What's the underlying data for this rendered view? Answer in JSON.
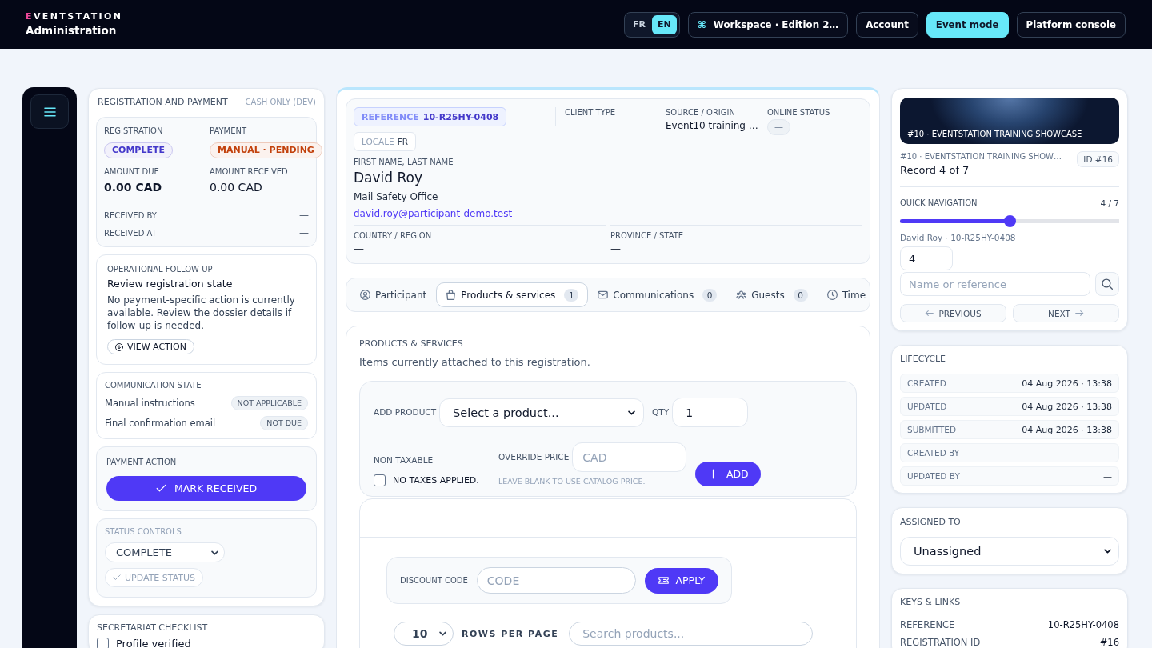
{
  "header": {
    "brand": "EVENTSTATION",
    "subtitle": "Administration",
    "languages": [
      {
        "label": "FR",
        "selected": false
      },
      {
        "label": "EN",
        "selected": true
      }
    ],
    "actions": [
      {
        "kind": "workspace",
        "icon": "⌘",
        "label": "Workspace · Edition 2…",
        "selected": false
      },
      {
        "kind": "plain",
        "label": "Account",
        "selected": false
      },
      {
        "kind": "plain",
        "label": "Event mode",
        "selected": true
      },
      {
        "kind": "plain",
        "label": "Platform console",
        "selected": false
      }
    ]
  },
  "payment_panel": {
    "title": "REGISTRATION AND PAYMENT",
    "mode": "CASH ONLY (DEV)",
    "summary": {
      "statuses": [
        {
          "label": "REGISTRATION",
          "value": "COMPLETE",
          "color": "#4338ca"
        },
        {
          "label": "PAYMENT",
          "value": "MANUAL · PENDING",
          "color": "#c2410c"
        }
      ],
      "amount_due": {
        "label": "AMOUNT DUE",
        "value": "0.00 CAD"
      },
      "amount_received": {
        "label": "AMOUNT RECEIVED",
        "value": "0.00 CAD"
      },
      "details": [
        {
          "label": "RECEIVED BY",
          "value": "—"
        },
        {
          "label": "RECEIVED AT",
          "value": "—"
        }
      ]
    },
    "follow_up": {
      "label": "OPERATIONAL FOLLOW-UP",
      "title": "Review registration state",
      "text": "No payment-specific action is currently available. Review the dossier details if follow-up is needed.",
      "action": "VIEW ACTION"
    },
    "communication": {
      "label": "COMMUNICATION STATE",
      "items": [
        {
          "label": "Manual instructions",
          "status": "NOT APPLICABLE"
        },
        {
          "label": "Final confirmation email",
          "status": "NOT DUE"
        }
      ]
    },
    "payment_action": {
      "label": "PAYMENT ACTION",
      "button": "MARK RECEIVED"
    },
    "status_controls": {
      "label": "STATUS CONTROLS",
      "value": "COMPLETE",
      "button": "UPDATE STATUS",
      "disabled": true
    }
  },
  "checklist": {
    "title": "SECRETARIAT CHECKLIST",
    "items": [
      {
        "label": "Profile verified",
        "checked": false
      }
    ]
  },
  "participant": {
    "reference_label": "REFERENCE",
    "reference": "10-R25HY-0408",
    "locale_label": "LOCALE",
    "locale": "FR",
    "fields": [
      {
        "kind": "text",
        "label": "CLIENT TYPE",
        "value": "—"
      },
      {
        "kind": "text",
        "label": "SOURCE / ORIGIN",
        "value": "Event10 training …"
      },
      {
        "kind": "pill",
        "label": "ONLINE STATUS",
        "value": "—"
      }
    ],
    "name_label": "FIRST NAME, LAST NAME",
    "name": "David Roy",
    "organization": "Mail Safety Office",
    "email": "david.roy@participant-demo.test",
    "location": [
      {
        "label": "COUNTRY / REGION",
        "value": "—"
      },
      {
        "label": "PROVINCE / STATE",
        "value": "—"
      }
    ]
  },
  "tabs": [
    {
      "label": "Participant",
      "selected": false
    },
    {
      "label": "Products & services",
      "count": "1",
      "selected": true
    },
    {
      "label": "Communications",
      "count": "0",
      "selected": false
    },
    {
      "label": "Guests",
      "count": "0",
      "selected": false
    },
    {
      "label": "Time",
      "selected": false
    }
  ],
  "products": {
    "title": "PRODUCTS & SERVICES",
    "subtitle": "Items currently attached to this registration.",
    "add_form": {
      "product_label": "ADD PRODUCT",
      "product_value": "Select a product...",
      "qty_label": "QTY",
      "qty_value": "1",
      "non_taxable_label": "NON TAXABLE",
      "no_taxes_label": "NO TAXES APPLIED.",
      "no_taxes_checked": false,
      "override_label": "OVERRIDE PRICE",
      "override_placeholder": "CAD",
      "override_hint": "LEAVE BLANK TO USE CATALOG PRICE.",
      "add_button": "ADD"
    },
    "discount": {
      "label": "DISCOUNT CODE",
      "placeholder": "CODE",
      "button": "APPLY"
    },
    "table_controls": {
      "rows_per_page": "10",
      "rows_label": "ROWS PER PAGE",
      "search_placeholder": "Search products..."
    }
  },
  "record": {
    "banner_caption": "#10 · EVENTSTATION TRAINING SHOWCASE",
    "event": "#10 · EVENTSTATION TRAINING SHOW…",
    "id_badge": "ID #16",
    "position": "Record 4 of 7",
    "quick_navigation": {
      "label": "QUICK NAVIGATION",
      "count": "4 / 7",
      "level": 0.5
    },
    "current": "David Roy · 10-R25HY-0408",
    "jump_value": "4",
    "search_placeholder": "Name or reference",
    "previous": "PREVIOUS",
    "next": "NEXT"
  },
  "lifecycle": {
    "title": "LIFECYCLE",
    "rows": [
      {
        "label": "CREATED",
        "value": "04 Aug 2026 · 13:38"
      },
      {
        "label": "UPDATED",
        "value": "04 Aug 2026 · 13:38"
      },
      {
        "label": "SUBMITTED",
        "value": "04 Aug 2026 · 13:38"
      },
      {
        "label": "CREATED BY",
        "value": "—"
      },
      {
        "label": "UPDATED BY",
        "value": "—"
      }
    ]
  },
  "assignment": {
    "label": "ASSIGNED TO",
    "value": "Unassigned"
  },
  "keys": {
    "title": "KEYS & LINKS",
    "rows": [
      {
        "label": "REFERENCE",
        "value": "10-R25HY-0408"
      },
      {
        "label": "REGISTRATION ID",
        "value": "#16"
      }
    ]
  }
}
